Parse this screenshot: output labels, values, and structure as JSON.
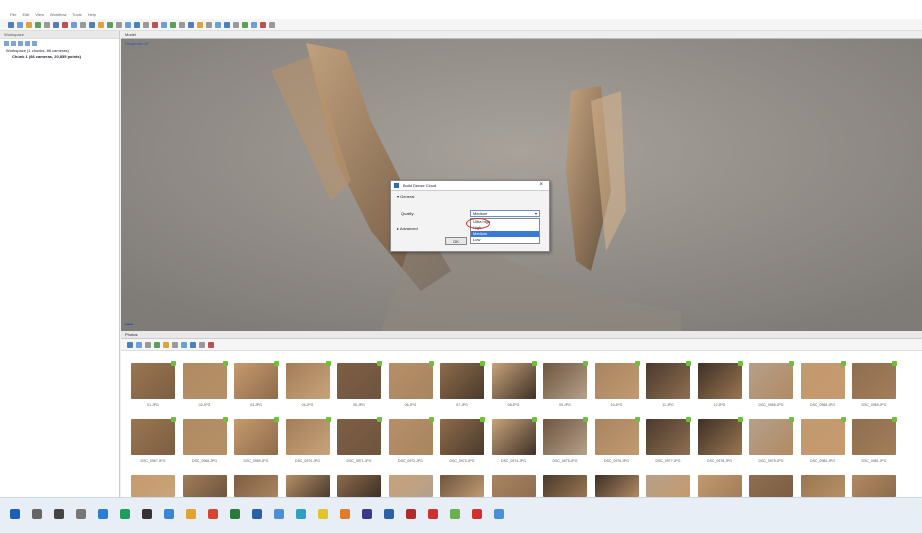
{
  "menu": [
    "File",
    "Edit",
    "View",
    "Workflow",
    "Tools",
    "Help"
  ],
  "workspace": {
    "title": "Workspace",
    "tree": [
      {
        "label": "Workspace (1 chunks, 86 cameras)"
      },
      {
        "label": "Chunk 1 (86 cameras, 20,855 points)"
      }
    ]
  },
  "viewport": {
    "tab": "Model",
    "corner_label": "Perspective 30°"
  },
  "dialog": {
    "title": "Build Dense Cloud",
    "section_general": "General",
    "quality_label": "Quality:",
    "quality_value": "Medium",
    "section_advanced": "Advanced",
    "options": [
      "Ultra high",
      "High",
      "Medium",
      "Low",
      "Lowest"
    ],
    "selected_option": "Medium",
    "ok_label": "OK",
    "cancel_label": "Cancel"
  },
  "photos": {
    "title": "Photos",
    "row1_captions": [
      "01.JPG",
      "02.JPG",
      "03.JPG",
      "04.JPG",
      "05.JPG",
      "06.JPG",
      "07.JPG",
      "08.JPG",
      "09.JPG",
      "10.JPG",
      "11.JPG",
      "12.JPG",
      "DSC_0966.JPG",
      "DSC_0968.JPG",
      "DSC_0969.JPG"
    ],
    "row2_captions": [
      "DSC_0967.JPG",
      "DSC_0968.JPG",
      "DSC_0969.JPG",
      "DSC_0970.JPG",
      "DSC_0971.JPG",
      "DSC_0972.JPG",
      "DSC_0973.JPG",
      "DSC_0974.JPG",
      "DSC_0975.JPG",
      "DSC_0976.JPG",
      "DSC_0977.JPG",
      "DSC_0978.JPG",
      "DSC_0979.JPG",
      "DSC_0980.JPG",
      "DSC_0981.JPG"
    ]
  },
  "colors": {
    "accent": "#3a79d8",
    "aligned_check": "#6cc13a"
  }
}
